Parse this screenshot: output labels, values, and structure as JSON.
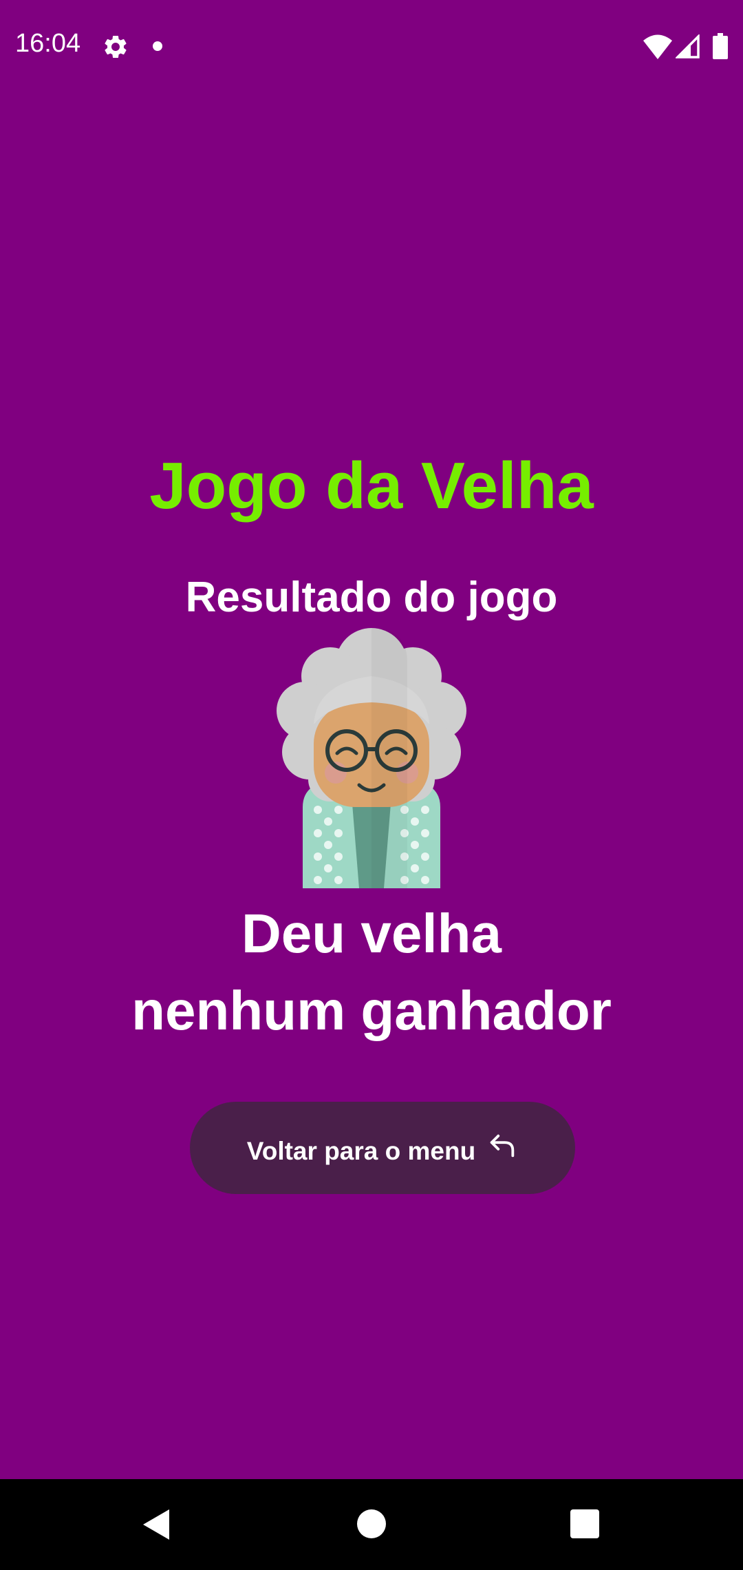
{
  "status_bar": {
    "time": "16:04",
    "icons": [
      "gear-icon",
      "notification-dot-icon",
      "wifi-icon",
      "signal-icon",
      "battery-icon"
    ]
  },
  "app": {
    "title": "Jogo da Velha",
    "subtitle": "Resultado do jogo",
    "result_line_1": "Deu velha",
    "result_line_2": "nenhum ganhador",
    "avatar_icon": "old-woman-avatar-icon"
  },
  "menu_button": {
    "label": "Voltar para o menu",
    "icon": "return-arrow-icon"
  },
  "nav_bar": {
    "icons": [
      "back-icon",
      "home-icon",
      "recents-icon"
    ]
  },
  "colors": {
    "background": "#800080",
    "title": "#76ee00",
    "text": "#ffffff",
    "button_background": "#4a1f4a",
    "nav_bar": "#000000"
  }
}
